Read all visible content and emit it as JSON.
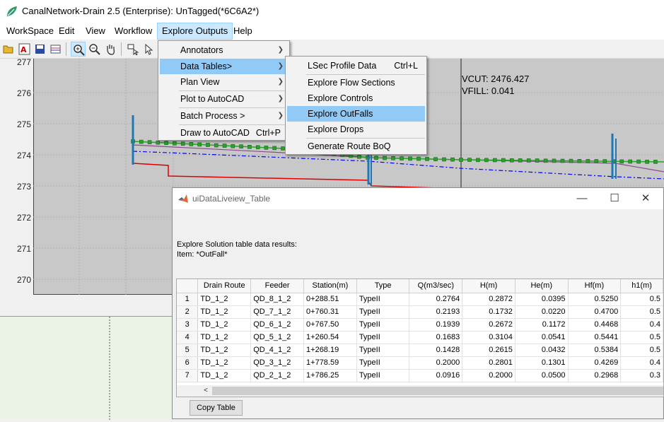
{
  "window": {
    "title": "CanalNetwork-Drain 2.5  (Enterprise): UnTagged(*6C6A2*)"
  },
  "menubar": [
    "WorkSpace",
    "Edit",
    "View",
    "Workflow",
    "Explore Outputs",
    "Help"
  ],
  "toolbar_icons": [
    "open-folder-icon",
    "text-label-icon",
    "save-icon",
    "table-icon",
    "zoom-in-icon",
    "zoom-out-icon",
    "pan-hand-icon",
    "data-cursor-icon",
    "pointer-icon"
  ],
  "plot": {
    "y_ticks": [
      "277",
      "276",
      "275",
      "274",
      "273",
      "272",
      "271",
      "270"
    ],
    "vcut": "VCUT: 2476.427",
    "vfill": "VFILL: 0.041"
  },
  "explore_menu": {
    "items": [
      {
        "label": "Annotators",
        "arrow": "❯"
      },
      {
        "label": "Data Tables>",
        "arrow": "❯"
      },
      {
        "label": "Plan View",
        "arrow": "❯"
      },
      {
        "label": "Plot to AutoCAD",
        "arrow": "❯"
      },
      {
        "label": "Batch Process >",
        "arrow": "❯"
      },
      {
        "label": "Draw to AutoCAD",
        "shortcut": "Ctrl+P"
      }
    ]
  },
  "data_tables_submenu": {
    "items": [
      {
        "label": "LSec Profile Data",
        "shortcut": "Ctrl+L"
      },
      {
        "label": "Explore Flow Sections"
      },
      {
        "label": "Explore Controls"
      },
      {
        "label": "Explore OutFalls"
      },
      {
        "label": "Explore Drops"
      },
      {
        "label": "Generate Route BoQ"
      }
    ]
  },
  "dialog": {
    "title": "uiDataLiveiew_Table",
    "minimize": "—",
    "maximize": "☐",
    "close": "✕",
    "desc1": "Explore Solution table data results:",
    "desc2": "Item: *OutFall*",
    "copy_button": "Copy Table",
    "scroll_left": "<",
    "columns": [
      "Drain Route",
      "Feeder",
      "Station(m)",
      "Type",
      "Q(m3/sec)",
      "H(m)",
      "He(m)",
      "Hf(m)",
      "h1(m)"
    ],
    "rows": [
      [
        "1",
        "TD_1_2",
        "QD_8_1_2",
        "0+288.51",
        "TypeII",
        "0.2764",
        "0.2872",
        "0.0395",
        "0.5250",
        "0.5"
      ],
      [
        "2",
        "TD_1_2",
        "QD_7_1_2",
        "0+760.31",
        "TypeII",
        "0.2193",
        "0.1732",
        "0.0220",
        "0.4700",
        "0.5"
      ],
      [
        "3",
        "TD_1_2",
        "QD_6_1_2",
        "0+767.50",
        "TypeII",
        "0.1939",
        "0.2672",
        "0.1172",
        "0.4468",
        "0.4"
      ],
      [
        "4",
        "TD_1_2",
        "QD_5_1_2",
        "1+260.54",
        "TypeII",
        "0.1683",
        "0.3104",
        "0.0541",
        "0.5441",
        "0.5"
      ],
      [
        "5",
        "TD_1_2",
        "QD_4_1_2",
        "1+268.19",
        "TypeII",
        "0.1428",
        "0.2615",
        "0.0432",
        "0.5384",
        "0.5"
      ],
      [
        "6",
        "TD_1_2",
        "QD_3_1_2",
        "1+778.59",
        "TypeII",
        "0.2000",
        "0.2801",
        "0.1301",
        "0.4269",
        "0.4"
      ],
      [
        "7",
        "TD_1_2",
        "QD_2_1_2",
        "1+786.25",
        "TypeII",
        "0.0916",
        "0.2000",
        "0.0500",
        "0.2968",
        "0.3"
      ]
    ]
  },
  "colors": {
    "menu_highlight": "#91c9f7",
    "profile_green": "#2ca02c",
    "invert_red": "#e00000",
    "hgl_blue": "#0000ff",
    "outfall_blue": "#1f77b4"
  }
}
